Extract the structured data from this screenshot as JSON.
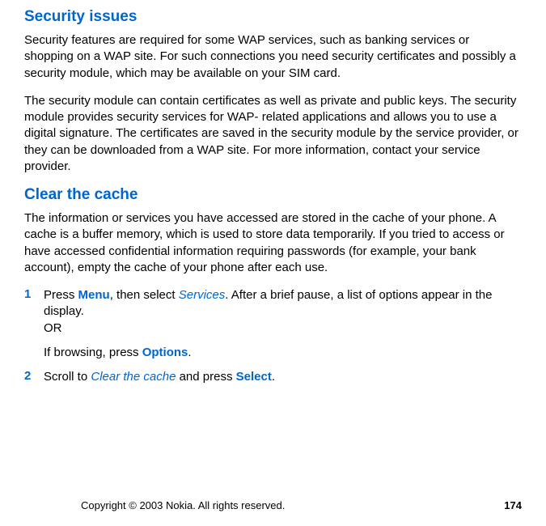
{
  "sections": {
    "security": {
      "heading": "Security issues",
      "para1": "Security features are required for some WAP services, such as banking services or shopping on a WAP site. For such connections you need security certificates and possibly a security module, which may be available on your SIM card.",
      "para2": "The security module can contain certificates as well as private and public keys. The security module provides security services for WAP- related applications and allows you to use a digital signature. The certificates are saved in the security module by the service provider, or they can be downloaded from a WAP site. For more information, contact your service provider."
    },
    "clearcache": {
      "heading": "Clear the cache",
      "para1": "The information or services you have accessed are stored in the cache of your phone. A cache is a buffer memory, which is used to store data temporarily. If you tried to access or have accessed confidential information requiring passwords (for example, your bank account), empty the cache of your phone after each use.",
      "steps": [
        {
          "number": "1",
          "text_pre": "Press ",
          "menu": "Menu",
          "text_mid1": ", then select ",
          "services": "Services",
          "text_mid2": ". After a brief pause, a list of options appear in the display.",
          "or": "OR",
          "text_browsing_pre": "If browsing, press ",
          "options": "Options",
          "text_after": "."
        },
        {
          "number": "2",
          "text_pre": "Scroll to ",
          "clearcache": "Clear the cache",
          "text_mid": " and press ",
          "select": "Select",
          "text_after": "."
        }
      ]
    }
  },
  "footer": {
    "copyright": "Copyright © 2003 Nokia. All rights reserved.",
    "page": "174"
  }
}
